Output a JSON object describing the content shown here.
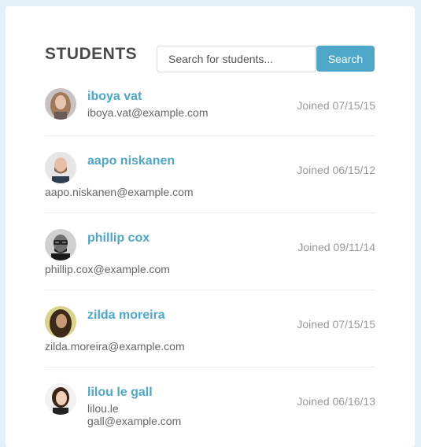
{
  "header": {
    "title": "STUDENTS",
    "search_placeholder": "Search for students...",
    "search_button": "Search"
  },
  "students": [
    {
      "name": "iboya vat",
      "email": "iboya.vat@example.com",
      "joined": "Joined 07/15/15",
      "avatar": "woman-long-hair-avatar"
    },
    {
      "name": "aapo niskanen",
      "email": "aapo.niskanen@example.com",
      "joined": "Joined 06/15/12",
      "avatar": "bearded-man-avatar"
    },
    {
      "name": "phillip cox",
      "email": "phillip.cox@example.com",
      "joined": "Joined 09/11/14",
      "avatar": "man-glasses-avatar"
    },
    {
      "name": "zilda moreira",
      "email": "zilda.moreira@example.com",
      "joined": "Joined 07/15/15",
      "avatar": "woman-dark-hair-avatar"
    },
    {
      "name": "lilou le gall",
      "email": "lilou.le\ngall@example.com",
      "joined": "Joined 06/16/13",
      "avatar": "woman-smiling-avatar"
    }
  ],
  "colors": {
    "accent": "#4ea7c8",
    "background": "#e3f1f7"
  }
}
